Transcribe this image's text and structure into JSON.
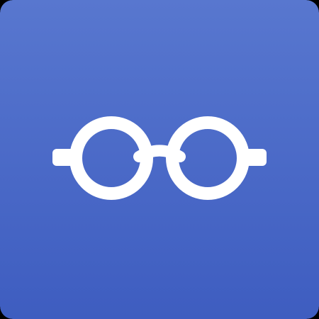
{
  "app_icon": {
    "icon": "glasses-icon",
    "colors": {
      "background_top": "#5877CF",
      "background_bottom": "#3E5DC0",
      "glyph": "#FFFFFF"
    }
  }
}
